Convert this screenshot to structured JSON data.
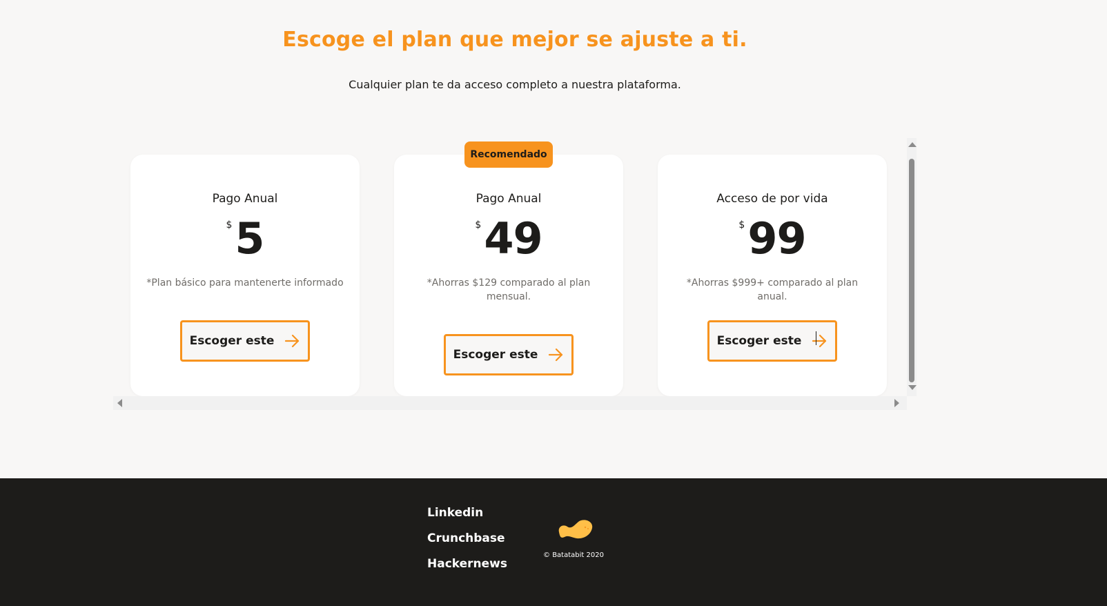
{
  "pricing": {
    "headline": "Escoge el plan que mejor se ajuste a ti.",
    "subtitle": "Cualquier plan te da acceso completo a nuestra plataforma.",
    "badge": "Recomendado",
    "plans": [
      {
        "name": "Pago Anual",
        "currency": "$",
        "price": "5",
        "note": "*Plan básico para mantenerte informado",
        "button": "Escoger este"
      },
      {
        "name": "Pago Anual",
        "currency": "$",
        "price": "49",
        "note": "*Ahorras $129 comparado al plan mensual.",
        "button": "Escoger este"
      },
      {
        "name": "Acceso de por vida",
        "currency": "$",
        "price": "99",
        "note": "*Ahorras $999+ comparado al plan anual.",
        "button": "Escoger este"
      }
    ]
  },
  "footer": {
    "links": [
      "Linkedin",
      "Crunchbase",
      "Hackernews"
    ],
    "copyright": "© Batatabit 2020"
  },
  "colors": {
    "accent": "#f7931e",
    "dark": "#1d1c1a",
    "background": "#f8f7f6",
    "logo": "#ffbf48"
  },
  "icons": {
    "button_arrow": "arrow-right-icon",
    "logo": "batatabit-logo-icon"
  }
}
